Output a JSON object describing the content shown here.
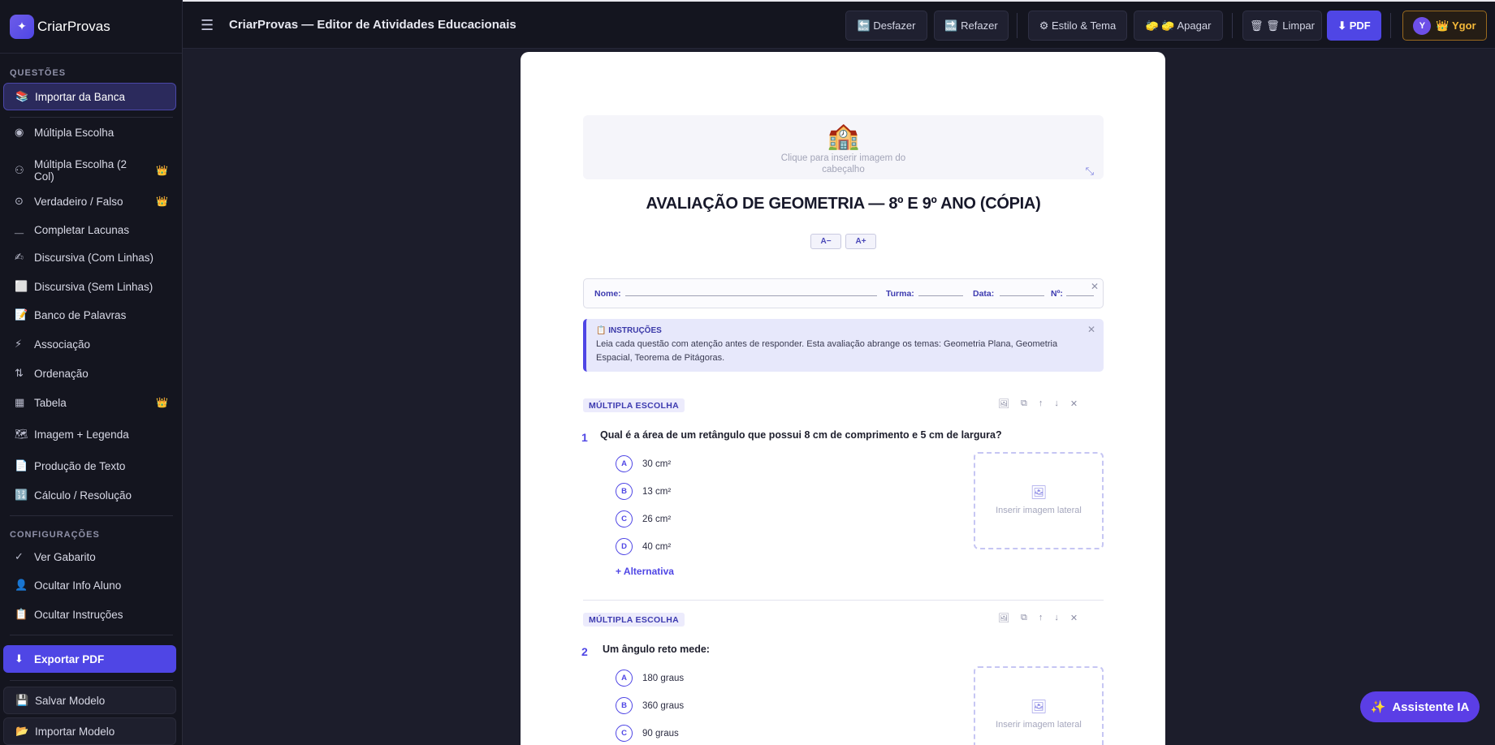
{
  "app": {
    "brand": "CriarProvas",
    "page_title": "CriarProvas — Editor de Atividades Educacionais"
  },
  "sidebar": {
    "section_questions": "QUESTÕES",
    "import_bank": "Importar da Banca",
    "items": [
      {
        "icon": "◉",
        "label": "Múltipla Escolha",
        "crown": ""
      },
      {
        "icon": "⚇",
        "label": "Múltipla Escolha (2 Col)",
        "crown": "👑"
      },
      {
        "icon": "⊙",
        "label": "Verdadeiro / Falso",
        "crown": "👑"
      },
      {
        "icon": "__",
        "label": "Completar Lacunas",
        "crown": ""
      },
      {
        "icon": "✍",
        "label": "Discursiva (Com Linhas)",
        "crown": ""
      },
      {
        "icon": "⬜",
        "label": "Discursiva (Sem Linhas)",
        "crown": ""
      },
      {
        "icon": "📝",
        "label": "Banco de Palavras",
        "crown": ""
      },
      {
        "icon": "⚡",
        "label": "Associação",
        "crown": ""
      },
      {
        "icon": "⇅",
        "label": "Ordenação",
        "crown": ""
      },
      {
        "icon": "▦",
        "label": "Tabela",
        "crown": "👑"
      },
      {
        "icon": "🗺",
        "label": "Imagem + Legenda",
        "crown": ""
      },
      {
        "icon": "📄",
        "label": "Produção de Texto",
        "crown": ""
      },
      {
        "icon": "🔢",
        "label": "Cálculo / Resolução",
        "crown": ""
      }
    ],
    "section_settings": "CONFIGURAÇÕES",
    "settings": [
      {
        "icon": "✓",
        "label": "Ver Gabarito"
      },
      {
        "icon": "👤",
        "label": "Ocultar Info Aluno"
      },
      {
        "icon": "📋",
        "label": "Ocultar Instruções"
      }
    ],
    "export_pdf": "Exportar PDF",
    "save_model": "Salvar Modelo",
    "import_model": "Importar Modelo"
  },
  "toolbar": {
    "undo": "🔙 Desfazer",
    "redo": "🔜 Refazer",
    "style": "⚙ Estilo & Tema",
    "erase": "🧽 🧽 Apagar",
    "clear": "🗑 🗑 Limpar",
    "pdf": "⬇ PDF",
    "user_initial": "Y",
    "user_name": "👑 Ygor"
  },
  "paper": {
    "header_image_hint": "Clique para inserir imagem do cabeçalho",
    "title": "AVALIAÇÃO DE GEOMETRIA — 8º E 9º ANO (CÓPIA)",
    "font_minus": "A−",
    "font_plus": "A+",
    "student_fields": {
      "name": "Nome:",
      "class": "Turma:",
      "date": "Data:",
      "number": "Nº:"
    },
    "instructions_title": "📋 INSTRUÇÕES",
    "instructions_text": "Leia cada questão com atenção antes de responder. Esta avaliação abrange os temas: Geometria Plana, Geometria Espacial, Teorema de Pitágoras.",
    "side_image_label": "Inserir imagem lateral",
    "add_alternative": "+ Alternativa",
    "questions": [
      {
        "type": "MÚLTIPLA ESCOLHA",
        "number": "1",
        "text": "Qual é a área de um retângulo que possui 8 cm de comprimento e 5 cm de largura?",
        "options": [
          {
            "letter": "A",
            "text": "30 cm²"
          },
          {
            "letter": "B",
            "text": "13 cm²"
          },
          {
            "letter": "C",
            "text": "26 cm²"
          },
          {
            "letter": "D",
            "text": "40 cm²"
          }
        ]
      },
      {
        "type": "MÚLTIPLA ESCOLHA",
        "number": "2",
        "text": "Um ângulo reto mede:",
        "options": [
          {
            "letter": "A",
            "text": "180 graus"
          },
          {
            "letter": "B",
            "text": "360 graus"
          },
          {
            "letter": "C",
            "text": "90 graus"
          }
        ]
      }
    ]
  },
  "ai_assistant": "Assistente IA"
}
